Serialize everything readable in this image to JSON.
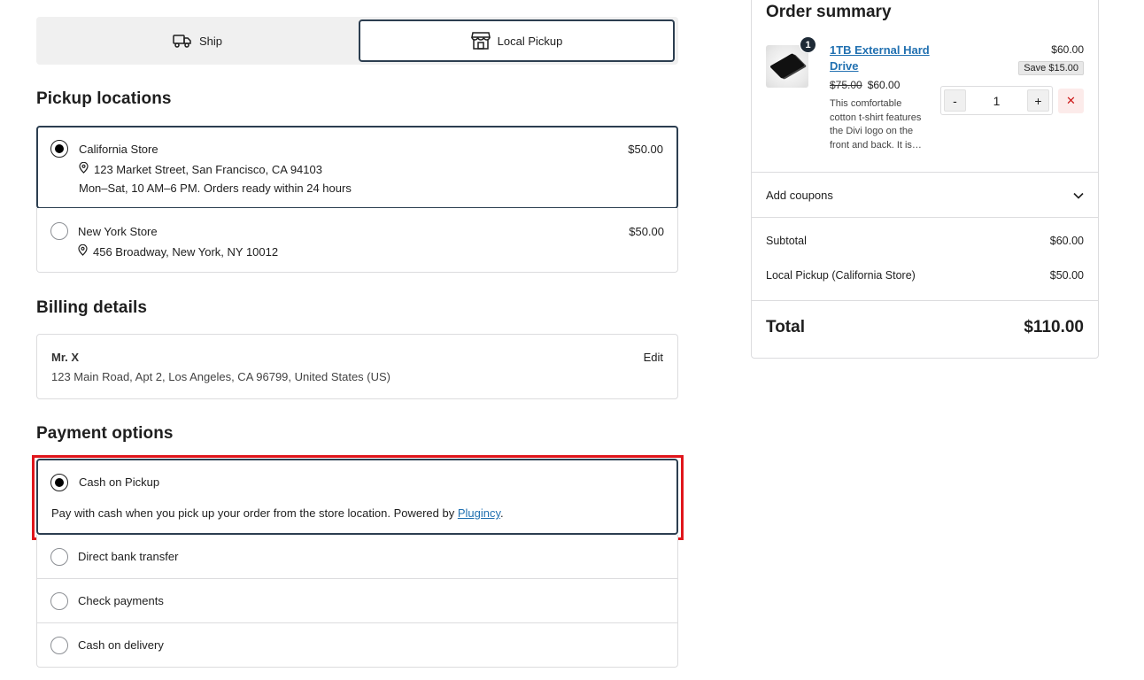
{
  "shipping_method": {
    "ship_label": "Ship",
    "pickup_label": "Local Pickup",
    "selected": "Local Pickup"
  },
  "pickup": {
    "title": "Pickup locations",
    "locations": [
      {
        "name": "California Store",
        "price": "$50.00",
        "address": "123 Market Street, San Francisco, CA 94103",
        "hours": "Mon–Sat, 10 AM–6 PM. Orders ready within 24 hours",
        "selected": true
      },
      {
        "name": "New York Store",
        "price": "$50.00",
        "address": "456 Broadway, New York, NY 10012",
        "selected": false
      }
    ]
  },
  "billing": {
    "title": "Billing details",
    "name": "Mr. X",
    "address": "123 Main Road, Apt 2, Los Angeles, CA 96799, United States (US)",
    "edit_label": "Edit"
  },
  "payment": {
    "title": "Payment options",
    "selected": {
      "name": "Cash on Pickup",
      "description": "Pay with cash when you pick up your order from the store location. Powered by ",
      "link_text": "Plugincy",
      "description_end": "."
    },
    "others": [
      "Direct bank transfer",
      "Check payments",
      "Cash on delivery"
    ],
    "highlight_color": "#e0161c"
  },
  "summary": {
    "title": "Order summary",
    "item": {
      "quantity_badge": "1",
      "name": "1TB External Hard Drive",
      "old_price": "$75.00",
      "price": "$60.00",
      "description": "This comfortable cotton t-shirt features the Divi logo on the front and back. It is…",
      "line_total": "$60.00",
      "save_badge": "Save $15.00",
      "quantity": "1",
      "minus_label": "-",
      "plus_label": "+",
      "remove_label": "✕"
    },
    "coupons_label": "Add coupons",
    "subtotal_label": "Subtotal",
    "subtotal_value": "$60.00",
    "shipping_label": "Local Pickup (California Store)",
    "shipping_value": "$50.00",
    "total_label": "Total",
    "total_value": "$110.00"
  },
  "colors": {
    "accent_border": "#2c3e50",
    "link": "#2271b1",
    "remove": "#cc1818"
  }
}
